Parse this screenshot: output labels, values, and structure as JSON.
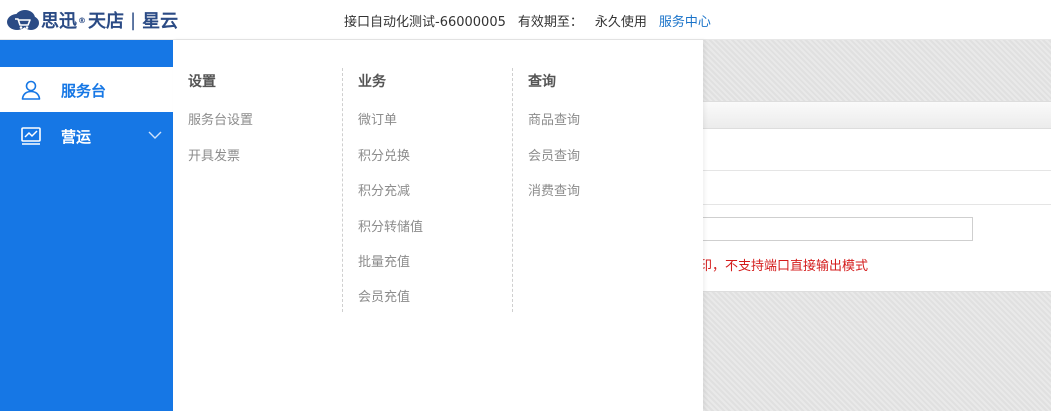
{
  "brand": {
    "name_part1": "思迅",
    "registered": "®",
    "name_part2": "天店",
    "separator": "|",
    "name_part3": "星云",
    "accent_color": "#1677e5"
  },
  "header": {
    "account": "接口自动化测试-66000005",
    "validity_label": "有效期至：",
    "validity_value": "永久使用",
    "service_link": "服务中心"
  },
  "sidebar": {
    "items": [
      {
        "label": "服务台",
        "icon": "user-icon",
        "active": true
      },
      {
        "label": "营运",
        "icon": "chart-monitor-icon",
        "active": false,
        "expandable": true
      }
    ]
  },
  "mega_menu": {
    "columns": [
      {
        "title": "设置",
        "items": [
          "服务台设置",
          "开具发票"
        ]
      },
      {
        "title": "业务",
        "items": [
          "微订单",
          "积分兑换",
          "积分充减",
          "积分转储值",
          "批量充值",
          "会员充值"
        ]
      },
      {
        "title": "查询",
        "items": [
          "商品查询",
          "会员查询",
          "消费查询"
        ]
      }
    ]
  },
  "background_panel": {
    "warning_text": "的打印，不支持端口直接输出模式",
    "warning_color": "#d41c1c"
  }
}
